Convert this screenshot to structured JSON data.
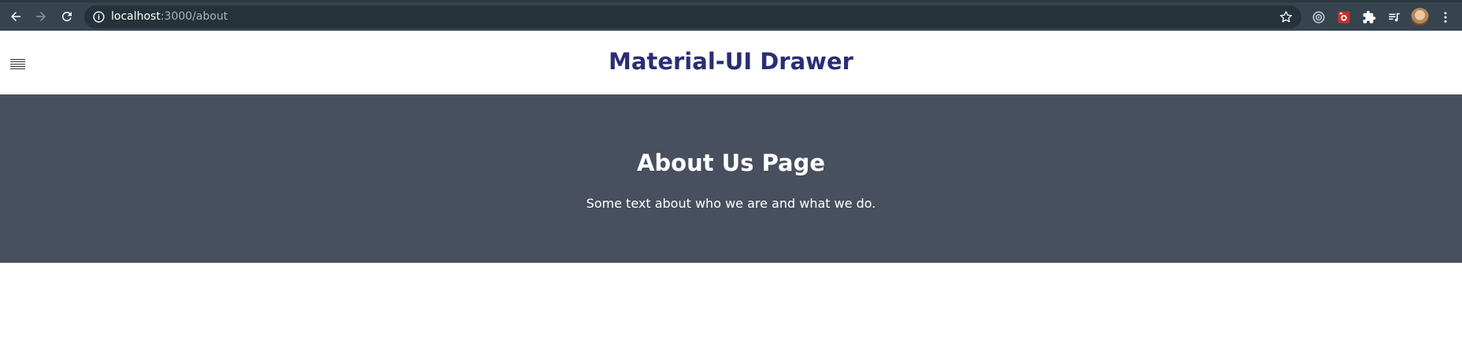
{
  "browser": {
    "url_host": "localhost",
    "url_path": ":3000/about",
    "icons": {
      "back": "back-arrow-icon",
      "forward": "forward-arrow-icon",
      "reload": "reload-icon",
      "info": "site-info-icon",
      "bookmark": "star-icon",
      "extensions": [
        "target-extension-icon",
        "red-extension-icon",
        "puzzle-extensions-icon",
        "media-queue-icon"
      ],
      "menu": "kebab-menu-icon"
    },
    "colors": {
      "toolbar": "#35444f",
      "omnibox": "#25323a"
    }
  },
  "header": {
    "title": "Material-UI Drawer",
    "menu_icon": "hamburger-menu-icon",
    "title_color": "#2b2e74"
  },
  "hero": {
    "title": "About Us Page",
    "text": "Some text about who we are and what we do.",
    "background": "#484f5e"
  }
}
